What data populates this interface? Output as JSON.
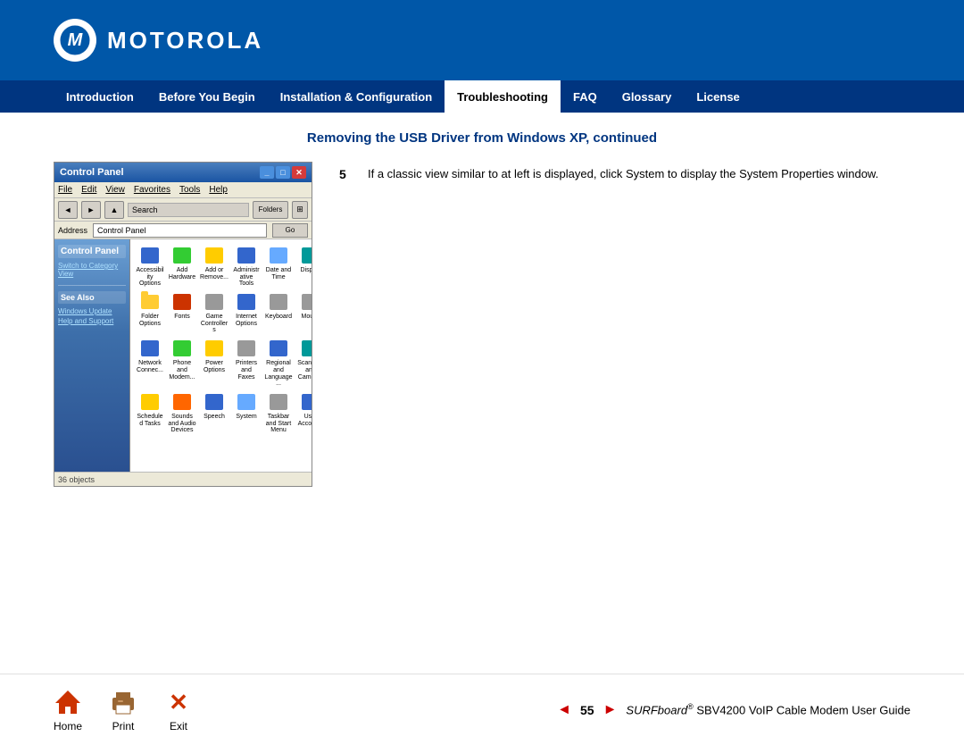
{
  "header": {
    "brand": "MOTOROLA",
    "logo_alt": "Motorola logo"
  },
  "nav": {
    "items": [
      {
        "id": "introduction",
        "label": "Introduction",
        "active": false
      },
      {
        "id": "before-you-begin",
        "label": "Before You Begin",
        "active": false
      },
      {
        "id": "installation-configuration",
        "label": "Installation & Configuration",
        "active": false
      },
      {
        "id": "troubleshooting",
        "label": "Troubleshooting",
        "active": true
      },
      {
        "id": "faq",
        "label": "FAQ",
        "active": false
      },
      {
        "id": "glossary",
        "label": "Glossary",
        "active": false
      },
      {
        "id": "license",
        "label": "License",
        "active": false
      }
    ]
  },
  "content": {
    "page_title": "Removing the USB Driver from Windows XP, continued",
    "step": {
      "number": "5",
      "text": "If a classic view similar to at left is displayed, click System to display the System Properties window."
    },
    "screenshot": {
      "title": "Control Panel",
      "address": "Control Panel",
      "menu_items": [
        "File",
        "Edit",
        "View",
        "Favorites",
        "Tools",
        "Help"
      ],
      "sidebar": {
        "title": "Control Panel",
        "switch_link": "Switch to Category View",
        "see_also": "See Also",
        "links": [
          "Windows Update",
          "Help and Support"
        ]
      },
      "icons": [
        {
          "label": "Accessibility Options"
        },
        {
          "label": "Add Hardware"
        },
        {
          "label": "Add or Remove..."
        },
        {
          "label": "Administrative Tools"
        },
        {
          "label": "Date and Time"
        },
        {
          "label": "Display"
        },
        {
          "label": "Folder Options"
        },
        {
          "label": "Fonts"
        },
        {
          "label": "Game Controllers"
        },
        {
          "label": "Internet Options"
        },
        {
          "label": "Keyboard"
        },
        {
          "label": "Mouse"
        },
        {
          "label": "Network Connec..."
        },
        {
          "label": "Phone and Modem..."
        },
        {
          "label": "Power Options"
        },
        {
          "label": "Printers and Faxes"
        },
        {
          "label": "Regional and Language..."
        },
        {
          "label": "Scanners and Cameras"
        },
        {
          "label": "Scheduled Tasks"
        },
        {
          "label": "Sounds and Audio Devices"
        },
        {
          "label": "Speech"
        },
        {
          "label": "System"
        },
        {
          "label": "Taskbar and Start Menu"
        },
        {
          "label": "User Accounts"
        }
      ],
      "statusbar": "36 objects"
    }
  },
  "footer": {
    "home_label": "Home",
    "print_label": "Print",
    "exit_label": "Exit",
    "page_number": "55",
    "doc_title": "SURFboard® SBV4200 VoIP Cable Modem User Guide"
  },
  "colors": {
    "header_bg": "#0057a8",
    "nav_bg": "#003580",
    "active_nav_bg": "#ffffff",
    "active_nav_text": "#000000",
    "nav_text": "#ffffff",
    "title_color": "#003580",
    "footer_arrow_color": "#cc0000"
  }
}
